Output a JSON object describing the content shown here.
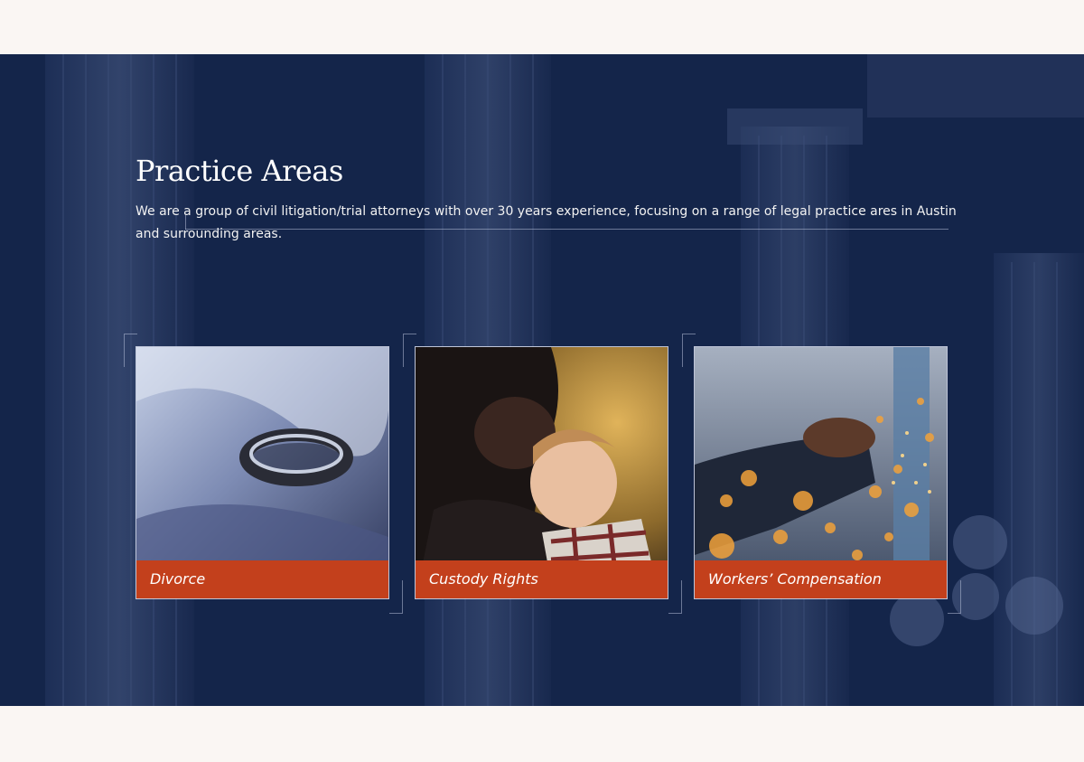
{
  "section": {
    "title": "Practice Areas",
    "intro": "We are a group of civil litigation/trial attorneys with over 30 years experience, focusing on a range of legal practice ares in Austin and surrounding areas."
  },
  "practice_areas": [
    {
      "label": "Divorce",
      "image": "wedding-ring-image"
    },
    {
      "label": "Custody Rights",
      "image": "mother-and-child-image"
    },
    {
      "label": "Workers’ Compensation",
      "image": "welder-sparks-image"
    }
  ],
  "colors": {
    "page_background": "#faf6f3",
    "hero_overlay": "#14254a",
    "label_background": "#c3401c",
    "text": "#ffffff"
  }
}
